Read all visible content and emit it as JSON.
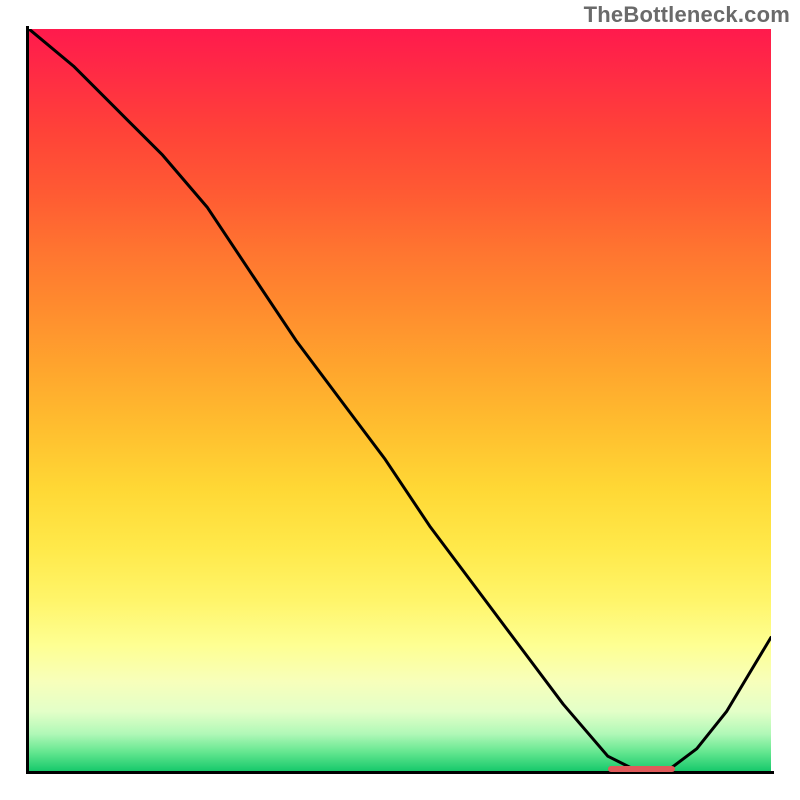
{
  "watermark": "TheBottleneck.com",
  "colors": {
    "curve": "#000000",
    "marker": "#e05a5a",
    "axis": "#000000"
  },
  "chart_data": {
    "type": "line",
    "title": "",
    "xlabel": "",
    "ylabel": "",
    "xlim": [
      0,
      100
    ],
    "ylim": [
      0,
      100
    ],
    "grid": false,
    "legend": false,
    "series": [
      {
        "name": "bottleneck-curve",
        "x": [
          0,
          6,
          12,
          18,
          24,
          30,
          36,
          42,
          48,
          54,
          60,
          66,
          72,
          78,
          82,
          86,
          90,
          94,
          97,
          100
        ],
        "y": [
          100,
          95,
          89,
          83,
          76,
          67,
          58,
          50,
          42,
          33,
          25,
          17,
          9,
          2,
          0,
          0,
          3,
          8,
          13,
          18
        ]
      }
    ],
    "annotations": [
      {
        "name": "optimal-range-marker",
        "x_start": 78,
        "x_end": 87,
        "y": 0.3,
        "label": ""
      }
    ]
  }
}
